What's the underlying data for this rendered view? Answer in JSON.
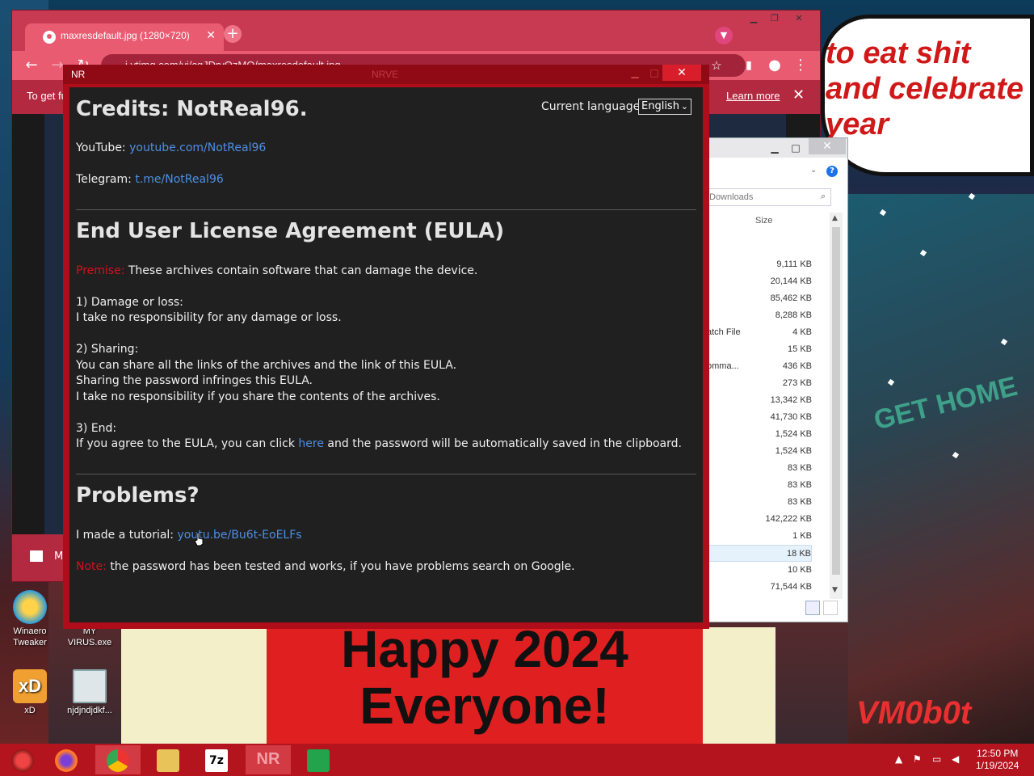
{
  "chrome": {
    "tab_title": "maxresdefault.jpg (1280×720)",
    "url": "i.ytimg.com/vi/cgJDrvOzMQ/maxresdefault.jpg",
    "infobar_text": "To get fu",
    "learn_more": "Learn more",
    "bottom_text": "M"
  },
  "wallpaper": {
    "banner_line1": "Happy 2024",
    "banner_line2": "Everyone!",
    "bubble_text": "to eat shit and celebrate year",
    "city_text": "GET HOME",
    "signature": "VM0b0t"
  },
  "desktop_icons": [
    {
      "label": "Winaero Tweaker"
    },
    {
      "label": "MY VIRUS.exe"
    },
    {
      "label": "xD"
    },
    {
      "label": "njdjndjdkf..."
    }
  ],
  "explorer": {
    "search_placeholder": "Downloads",
    "size_header": "Size",
    "rows": [
      {
        "name": "",
        "size": "9,111 KB"
      },
      {
        "name": "",
        "size": "20,144 KB"
      },
      {
        "name": "",
        "size": "85,462 KB"
      },
      {
        "name": "",
        "size": "8,288 KB"
      },
      {
        "name": "atch File",
        "size": "4 KB"
      },
      {
        "name": "",
        "size": "15 KB"
      },
      {
        "name": "omma...",
        "size": "436 KB"
      },
      {
        "name": "",
        "size": "273 KB"
      },
      {
        "name": "",
        "size": "13,342 KB"
      },
      {
        "name": "",
        "size": "41,730 KB"
      },
      {
        "name": "",
        "size": "1,524 KB"
      },
      {
        "name": "",
        "size": "1,524 KB"
      },
      {
        "name": "",
        "size": "83 KB"
      },
      {
        "name": "",
        "size": "83 KB"
      },
      {
        "name": "",
        "size": "83 KB"
      },
      {
        "name": "",
        "size": "142,222 KB"
      },
      {
        "name": "",
        "size": "1 KB"
      },
      {
        "name": "",
        "size": "18 KB"
      },
      {
        "name": "",
        "size": "10 KB"
      },
      {
        "name": "",
        "size": "71,544 KB"
      }
    ]
  },
  "nr": {
    "window_title": "NR",
    "ghost_title": "NRVE",
    "credits_title": "Credits: NotReal96.",
    "language_label": "Current language:",
    "language_value": "English",
    "youtube_label": "YouTube:",
    "youtube_link": "youtube.com/NotReal96",
    "telegram_label": "Telegram:",
    "telegram_link": "t.me/NotReal96",
    "eula_title": "End User License Agreement (EULA)",
    "premise_label": "Premise:",
    "premise_text": "These archives contain software that can damage the device.",
    "s1_title": "1) Damage or loss:",
    "s1_line1": "I take no responsibility for any damage or loss.",
    "s2_title": "2) Sharing:",
    "s2_line1": "You can share all the links of the archives and the link of this EULA.",
    "s2_line2": "Sharing the password infringes this EULA.",
    "s2_line3": "I take no responsibility if you share the contents of the archives.",
    "s3_title": "3) End:",
    "s3_pre": "If you agree to the EULA, you can click",
    "s3_link": "here",
    "s3_post": "and the password will be automatically saved in the clipboard.",
    "problems_title": "Problems?",
    "tutorial_label": "I made a tutorial:",
    "tutorial_link": "youtu.be/Bu6t-EoELFs",
    "note_label": "Note:",
    "note_text": "the password has been tested and works, if you have problems search on Google."
  },
  "taskbar": {
    "apps": [
      "start",
      "firefox",
      "chrome",
      "file-explorer",
      "7zip",
      "NR",
      "store"
    ],
    "nr_label": "NR",
    "time": "12:50 PM",
    "date": "1/19/2024"
  },
  "colors": {
    "accent_red": "#b00d1a",
    "link_blue": "#4d8fe6",
    "warn_red": "#d2121f",
    "panel_bg": "#202020"
  }
}
